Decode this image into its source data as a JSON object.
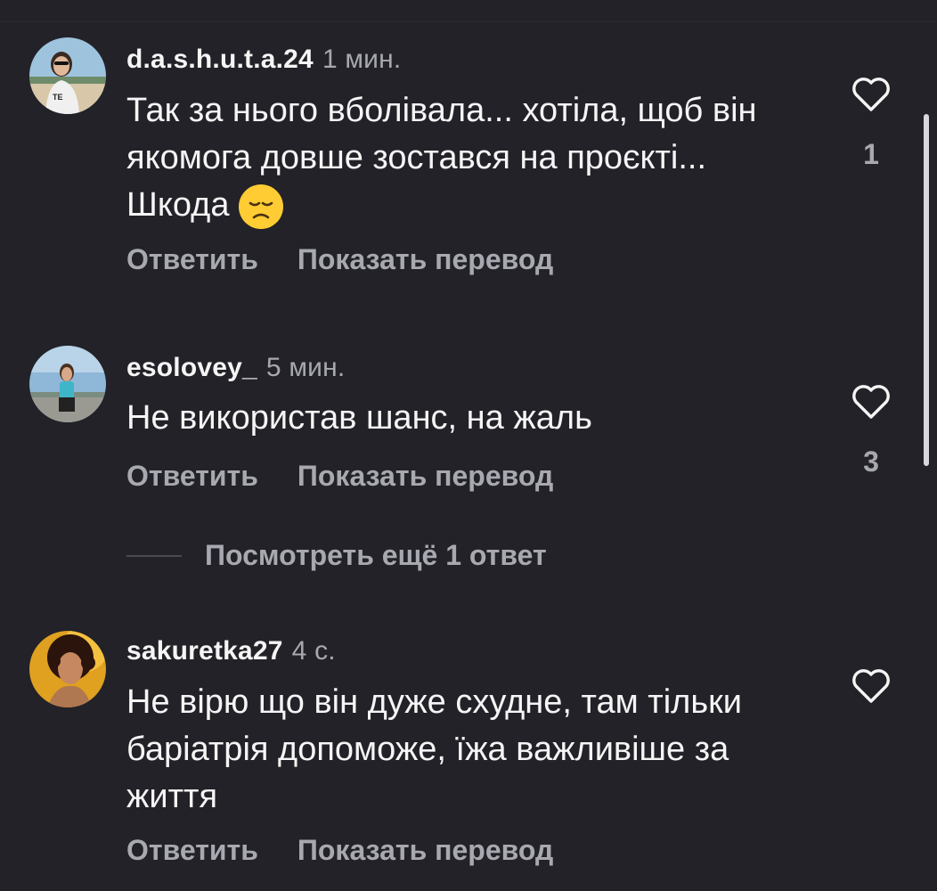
{
  "comments": [
    {
      "username": "d.a.s.h.u.t.a.24",
      "time": "1 мин.",
      "text": "Так за нього вболівала... хотіла, щоб він якомога довше зостався на проєкті... Шкода",
      "emoji": "disappointed-face",
      "reply_label": "Ответить",
      "translate_label": "Показать перевод",
      "like_count": "1"
    },
    {
      "username": "esolovey_",
      "time": "5 мин.",
      "text": "Не використав шанс, на жаль",
      "reply_label": "Ответить",
      "translate_label": "Показать перевод",
      "like_count": "3"
    },
    {
      "username": "sakuretka27",
      "time": "4 с.",
      "text": "Не вірю що він дуже схудне, там тільки баріатрія допоможе, їжа важливіше за життя",
      "reply_label": "Ответить",
      "translate_label": "Показать перевод",
      "like_count": ""
    }
  ],
  "more_replies_label": "Посмотреть ещё 1 ответ",
  "colors": {
    "background": "#222228",
    "primary_text": "#f5f5f5",
    "secondary_text": "#a8a8b0"
  }
}
